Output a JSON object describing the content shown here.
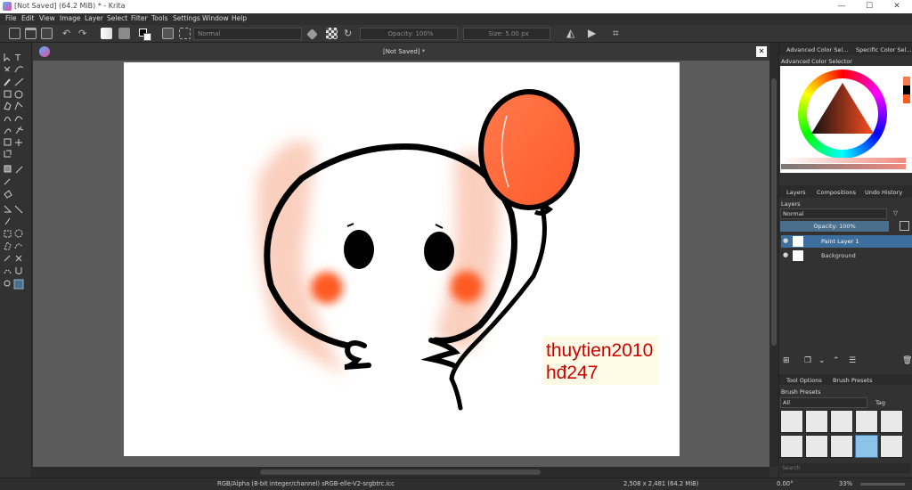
{
  "window": {
    "title": "[Not Saved]  (64.2 MiB)  * - Krita",
    "minimize": "—",
    "maximize": "☐",
    "close": "✕"
  },
  "menu": [
    "File",
    "Edit",
    "View",
    "Image",
    "Layer",
    "Select",
    "Filter",
    "Tools",
    "Settings",
    "Window",
    "Help"
  ],
  "toolbar": {
    "blend_mode": "Normal",
    "opacity": "Opacity: 100%",
    "size": "Size: 5.00 px"
  },
  "document": {
    "tab_title": "[Not Saved]  *",
    "tab_close": "✕"
  },
  "artwork": {
    "watermark_line1": "thuytien2010",
    "watermark_line2": "hđ247"
  },
  "dock": {
    "color_tabs": [
      "Advanced Color Sel...",
      "Specific Color Sel..."
    ],
    "color_selector_title": "Advanced Color Selector",
    "layer_tabs": [
      "Layers",
      "Compositions",
      "Undo History"
    ],
    "layers_title": "Layers",
    "blend_mode": "Normal",
    "opacity": "Opacity:  100%",
    "layers": [
      {
        "name": "Paint Layer 1",
        "active": true
      },
      {
        "name": "Background",
        "active": false
      }
    ],
    "tool_tabs": [
      "Tool Options",
      "Brush Presets"
    ],
    "brush_presets_title": "Brush Presets",
    "brush_filter": "All",
    "tag_label": "Tag",
    "search_placeholder": "Search"
  },
  "status": {
    "color_space": "RGB/Alpha (8-bit integer/channel)  sRGB-elle-V2-srgbtrc.icc",
    "dimensions": "2,508 x 2,481 (64.2 MiB)",
    "rotation": "0.00°",
    "zoom": "33%"
  },
  "colors": {
    "accent": "#3c6e9e",
    "balloon": "#ff6a3c",
    "watermark": "#cc0000"
  }
}
